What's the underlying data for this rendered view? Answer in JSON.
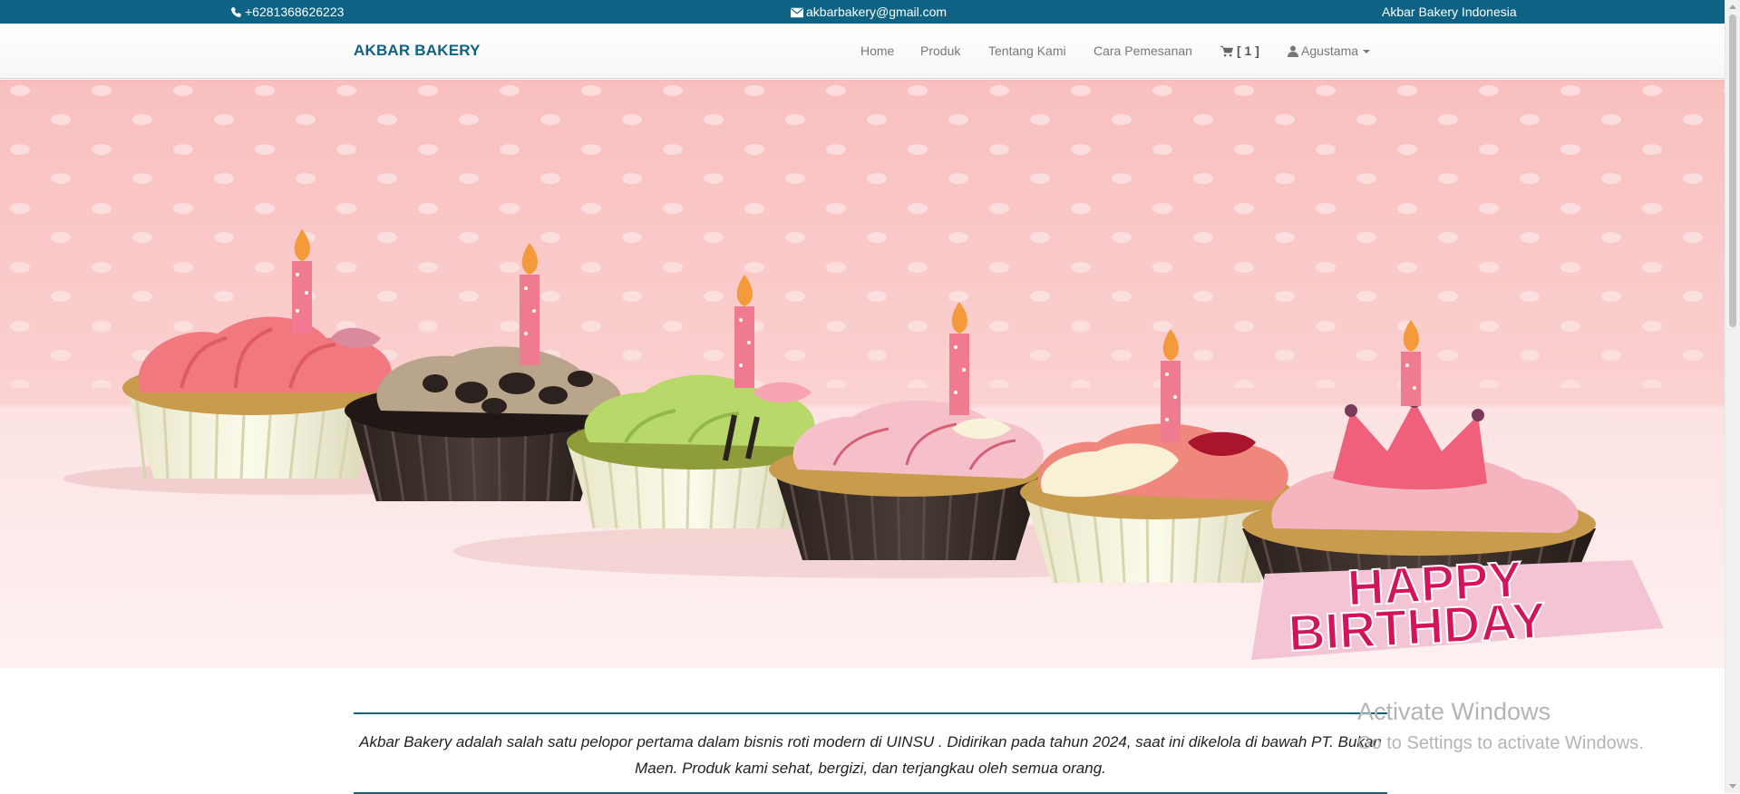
{
  "topbar": {
    "phone": "+6281368626223",
    "email": "akbarbakery@gmail.com",
    "brand": "Akbar Bakery Indonesia",
    "bg_color": "#0e6283"
  },
  "navbar": {
    "logo": "AKBAR BAKERY",
    "items": {
      "home": "Home",
      "produk": "Produk",
      "tentang": "Tentang Kami",
      "cara": "Cara Pemesanan",
      "cart": "[ 1 ]",
      "user": "Agustama"
    }
  },
  "hero": {
    "banner_text_line1": "HAPPY",
    "banner_text_line2": "BIRTHDAY",
    "icon": "cupcakes-banner-image"
  },
  "about": {
    "text": "Akbar Bakery adalah salah satu pelopor pertama dalam bisnis roti modern di UINSU . Didirikan pada tahun 2024, saat ini dikelola di bawah PT. Bukan Maen. Produk kami sehat, bergizi, dan terjangkau oleh semua orang."
  },
  "watermark": {
    "line1": "Activate Windows",
    "line2": "Go to Settings to activate Windows."
  },
  "colors": {
    "accent": "#0e6283",
    "hero_pink": "#f9c4c4",
    "banner_text": "#d4145a"
  }
}
